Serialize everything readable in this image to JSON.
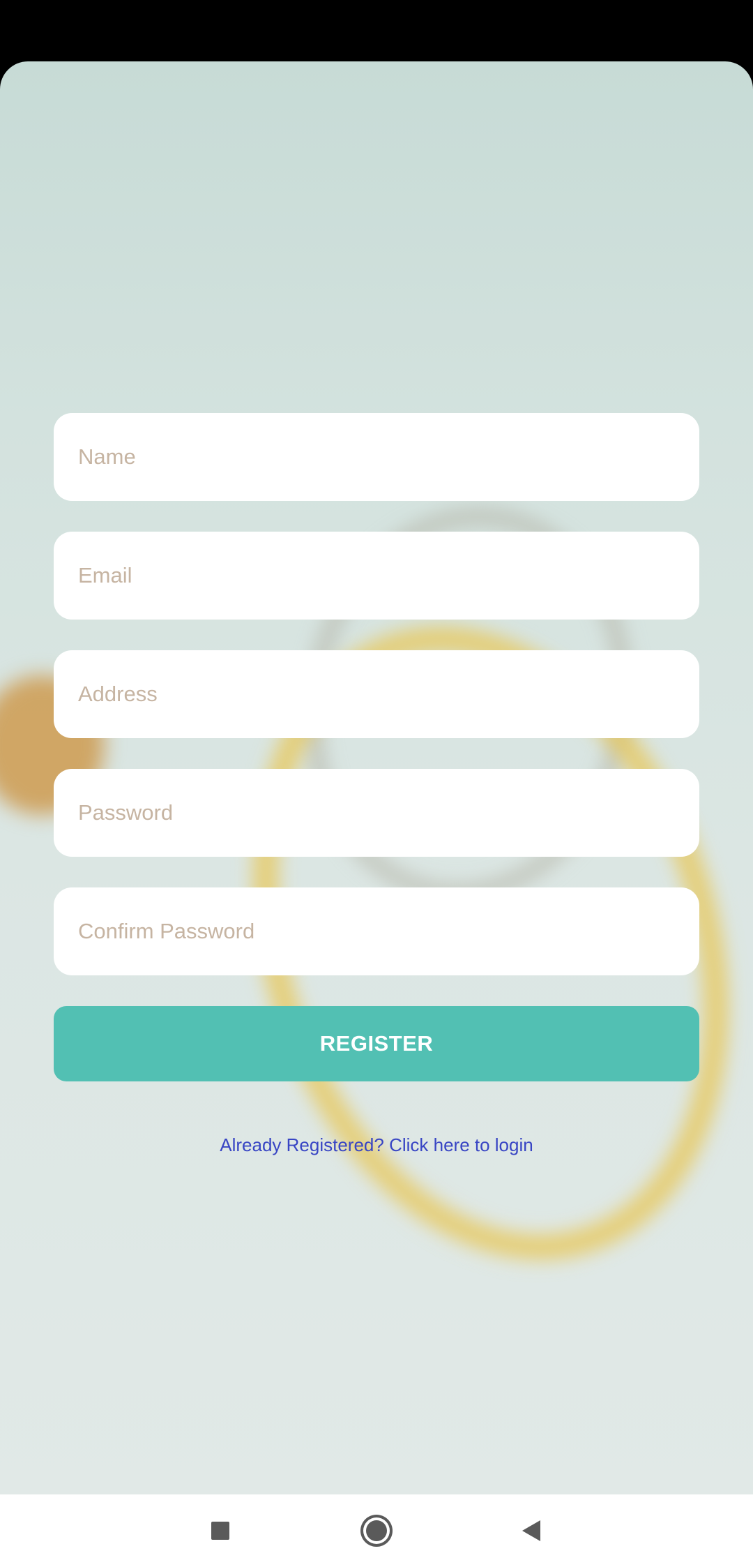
{
  "form": {
    "fields": [
      {
        "placeholder": "Name",
        "value": ""
      },
      {
        "placeholder": "Email",
        "value": ""
      },
      {
        "placeholder": "Address",
        "value": ""
      },
      {
        "placeholder": "Password",
        "value": ""
      },
      {
        "placeholder": "Confirm Password",
        "value": ""
      }
    ],
    "register_label": "REGISTER",
    "login_link": "Already Registered? Click here to login"
  },
  "navigation_bar": {
    "buttons": [
      "recent-apps-icon",
      "home-icon",
      "back-icon"
    ]
  },
  "colors": {
    "accent": "#52c0b3",
    "link": "#3845c4",
    "placeholder": "#c6b4a2"
  }
}
